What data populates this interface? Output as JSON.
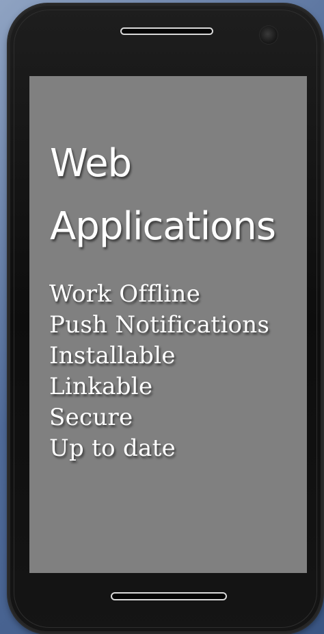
{
  "screen": {
    "title_lines": [
      "Web",
      "Applications"
    ],
    "features": [
      "Work Offline",
      "Push Notifications",
      "Installable",
      "Linkable",
      "Secure",
      "Up to date"
    ]
  },
  "device": {
    "colors": {
      "bezel": "#111111",
      "screen": "#808080",
      "text": "#ffffff",
      "background": "#4f6a98"
    }
  }
}
